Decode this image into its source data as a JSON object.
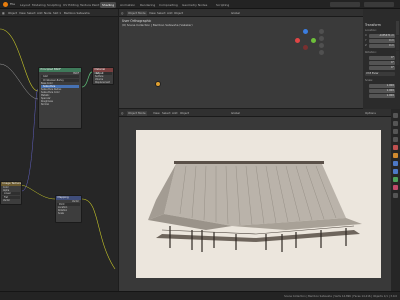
{
  "topbar": {
    "tabs": [
      "Layout",
      "Modeling",
      "Sculpting",
      "UV Editing",
      "Texture Paint",
      "Shading",
      "Animation",
      "Rendering",
      "Compositing",
      "Geometry Nodes",
      "Scripting"
    ],
    "active_tab": "Shading"
  },
  "node_editor": {
    "header": {
      "object": "Object",
      "view": "View",
      "select": "Select",
      "add": "Add",
      "node": "Node",
      "slot": "Slot 1",
      "material": "Bamboo Satavaha"
    },
    "nodes": [
      {
        "title": "Principled BSDF",
        "rows": [
          "BSDF",
          "GGX",
          "Christensen-Burley",
          "Base Color",
          "Subsurface",
          "Subsurface Radius",
          "Subsurface Color",
          "Metallic",
          "Specular",
          "Roughness",
          "Normal"
        ]
      },
      {
        "title": "Material Output",
        "rows": [
          "All",
          "Surface",
          "Volume",
          "Displacement"
        ]
      },
      {
        "title": "Image Texture",
        "rows": [
          "Color",
          "Alpha",
          "Linear",
          "Flat",
          "Repeat",
          "Vector"
        ]
      },
      {
        "title": "Mapping",
        "rows": [
          "Vector",
          "Point",
          "Location",
          "Rotation",
          "Scale"
        ]
      }
    ]
  },
  "viewport_top": {
    "header": {
      "mode": "Object Mode",
      "view": "View",
      "select": "Select",
      "add": "Add",
      "object": "Object",
      "transform": "Global"
    },
    "overlay_title": "User Orthographic",
    "overlay_sub": "(0) Scene Collection | Bamboo Satavaha (Vakaker)"
  },
  "transform_panel": {
    "title": "Transform",
    "location_label": "Location:",
    "x_label": "X",
    "y_label": "Y",
    "z_label": "Z",
    "loc_x": "-0.85471 m",
    "loc_y": "0 m",
    "loc_z": "0 m",
    "rotation_label": "Rotation:",
    "rot_x": "0°",
    "rot_y": "0°",
    "rot_z": "0°",
    "mode_label": "XYZ Euler",
    "scale_label": "Scale:",
    "sc_x": "1.000",
    "sc_y": "1.000",
    "sc_z": "1.000"
  },
  "viewport_bottom": {
    "header": {
      "mode": "Object Mode",
      "view": "View",
      "select": "Select",
      "add": "Add",
      "object": "Object",
      "transform": "Global",
      "options": "Options"
    }
  },
  "statusbar": {
    "right_text": "Scene Collection | Bamboo Satavaha | Verts 14,896 | Faces 14,216 | Objects 1/1 | 3.0.0"
  },
  "colors": {
    "accent": "#4772b3",
    "node_title_shader": "#3f7a5a",
    "node_title_output": "#7a3f3f",
    "node_title_texture": "#6b5a2f",
    "node_title_vector": "#3f4d7a",
    "link_shader": "#5fc07a",
    "link_color": "#c7c729",
    "link_vector": "#6363c7",
    "link_gray": "#a1a1a1"
  }
}
